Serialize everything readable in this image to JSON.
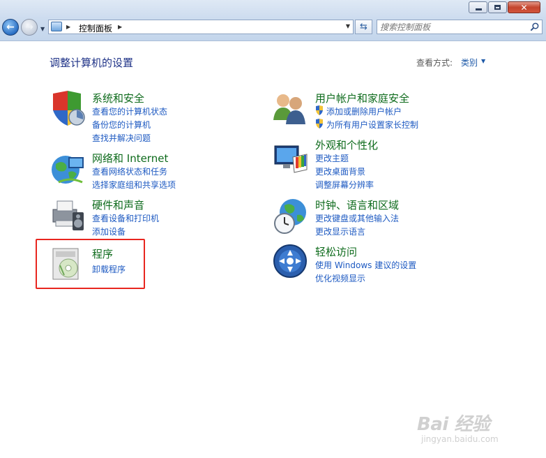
{
  "window": {
    "controls": [
      "minimize",
      "maximize",
      "close"
    ]
  },
  "navigation": {
    "back_icon": "back-arrow-icon",
    "forward_icon": "forward-arrow-icon"
  },
  "address_bar": {
    "path": "控制面板",
    "icon": "control-panel-icon"
  },
  "search": {
    "placeholder": "搜索控制面板"
  },
  "header": {
    "title": "调整计算机的设置",
    "view_by_label": "查看方式:",
    "view_by_value": "类别"
  },
  "categories": {
    "system": {
      "title": "系统和安全",
      "links": [
        "查看您的计算机状态",
        "备份您的计算机",
        "查找并解决问题"
      ]
    },
    "network": {
      "title": "网络和 Internet",
      "links": [
        "查看网络状态和任务",
        "选择家庭组和共享选项"
      ]
    },
    "hardware": {
      "title": "硬件和声音",
      "links": [
        "查看设备和打印机",
        "添加设备"
      ]
    },
    "programs": {
      "title": "程序",
      "links": [
        "卸载程序"
      ]
    },
    "users": {
      "title": "用户帐户和家庭安全",
      "links": [
        "添加或删除用户帐户",
        "为所有用户设置家长控制"
      ]
    },
    "appearance": {
      "title": "外观和个性化",
      "links": [
        "更改主题",
        "更改桌面背景",
        "调整屏幕分辨率"
      ]
    },
    "clock": {
      "title": "时钟、语言和区域",
      "links": [
        "更改键盘或其他输入法",
        "更改显示语言"
      ]
    },
    "ease": {
      "title": "轻松访问",
      "links": [
        "使用 Windows 建议的设置",
        "优化视频显示"
      ]
    }
  },
  "watermark": {
    "brand": "Bai 经验",
    "site": "jingyan.baidu.com"
  },
  "colors": {
    "category_title": "#0e6b1c",
    "link": "#1e5ac2",
    "highlight_box": "#e8261f"
  }
}
